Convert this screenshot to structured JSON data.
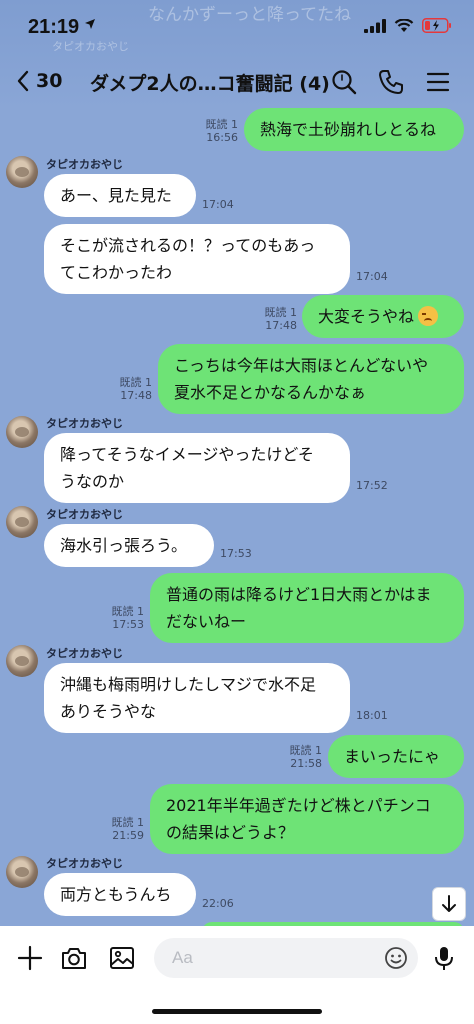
{
  "status": {
    "time": "21:19"
  },
  "ghost": {
    "top_text": "なんかずーっと降ってたね",
    "sender": "タピオカおやじ"
  },
  "header": {
    "back_count": "30",
    "title": "ダメプ2人の…コ奮闘記 (4)"
  },
  "messages": [
    {
      "dir": "out",
      "lines": [
        "熱海で土砂崩れしとるね"
      ],
      "read": "既読 1",
      "time": "16:56"
    },
    {
      "dir": "in",
      "sender": "タピオカおやじ",
      "lines": [
        "あー、見た見た"
      ],
      "time": "17:04"
    },
    {
      "dir": "in",
      "lines": [
        "そこが流されるの！？ってのもあっ",
        "てこわかったわ"
      ],
      "time": "17:04"
    },
    {
      "dir": "out",
      "lines": [
        "大変そうやね"
      ],
      "emoji": "persevering-face",
      "read": "既読 1",
      "time": "17:48"
    },
    {
      "dir": "out",
      "lines": [
        "こっちは今年は大雨ほとんどないや",
        "夏水不足とかなるんかなぁ"
      ],
      "read": "既読 1",
      "time": "17:48"
    },
    {
      "dir": "in",
      "sender": "タピオカおやじ",
      "lines": [
        "降ってそうなイメージやったけどそ",
        "うなのか"
      ],
      "time": "17:52"
    },
    {
      "dir": "in",
      "sender": "タピオカおやじ",
      "lines": [
        "海水引っ張ろう。"
      ],
      "time": "17:53"
    },
    {
      "dir": "out",
      "lines": [
        "普通の雨は降るけど1日大雨とかはま",
        "だないねー"
      ],
      "read": "既読 1",
      "time": "17:53"
    },
    {
      "dir": "in",
      "sender": "タピオカおやじ",
      "lines": [
        "沖縄も梅雨明けしたしマジで水不足",
        "ありそうやな"
      ],
      "time": "18:01"
    },
    {
      "dir": "out",
      "lines": [
        "まいったにゃ"
      ],
      "read": "既読 1",
      "time": "21:58"
    },
    {
      "dir": "out",
      "lines": [
        "2021年半年過ぎたけど株とパチンコ",
        "の結果はどうよ？"
      ],
      "read": "既読 1",
      "time": "21:59"
    },
    {
      "dir": "in",
      "sender": "タピオカおやじ",
      "lines": [
        "両方ともうんち"
      ],
      "time": "22:06"
    }
  ],
  "input": {
    "placeholder": "Aa"
  },
  "colors": {
    "background": "#8aa6d6",
    "outgoing_bubble": "#6ee376",
    "incoming_bubble": "#ffffff",
    "battery_low": "#e5383b"
  },
  "icons": [
    "location-arrow-icon",
    "signal-icon",
    "wifi-icon",
    "battery-icon",
    "back-chevron-icon",
    "search-icon",
    "phone-icon",
    "menu-icon",
    "scroll-down-icon",
    "plus-icon",
    "camera-icon",
    "image-icon",
    "emoji-icon",
    "mic-icon"
  ]
}
